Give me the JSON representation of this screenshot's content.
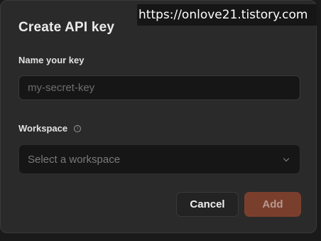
{
  "watermark": "https://onlove21.tistory.com",
  "dialog": {
    "title": "Create API key",
    "name_field": {
      "label": "Name your key",
      "placeholder": "my-secret-key",
      "value": ""
    },
    "workspace_field": {
      "label": "Workspace",
      "info_icon": "info-icon",
      "placeholder": "Select a workspace",
      "dropdown_icon": "chevron-down-icon"
    },
    "buttons": {
      "cancel_label": "Cancel",
      "add_label": "Add"
    }
  },
  "colors": {
    "background": "#2a2a2a",
    "input_background": "#161616",
    "add_button": "#7a3f2c",
    "text": "#ececec"
  }
}
